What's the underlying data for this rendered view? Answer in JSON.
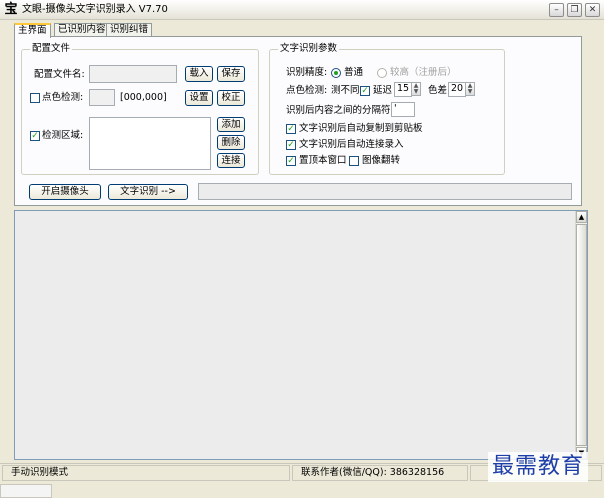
{
  "window": {
    "title": "文眼-摄像头文字识别录入 V7.70",
    "app_icon_glyph": "宝"
  },
  "titlebar_buttons": {
    "minimize": "–",
    "restore": "❐",
    "close": "✕"
  },
  "tabs": [
    {
      "label": "主界面",
      "active": true
    },
    {
      "label": "已识别内容",
      "active": false
    },
    {
      "label": "识别纠错",
      "active": false
    }
  ],
  "config": {
    "group_title": "配置文件",
    "config_name_label": "配置文件名:",
    "config_name_value": "",
    "load_button": "载入",
    "save_button": "保存",
    "color_detect_label": "点色检测:",
    "color_detect_checked": false,
    "color_detect_swatch": "",
    "color_detect_value": "[000,000]",
    "set_button": "设置",
    "calibrate_button": "校正",
    "detect_area_label": "检测区域:",
    "detect_area_checked": true,
    "detect_area_value": "",
    "add_button": "添加",
    "delete_button": "删除",
    "connect_button": "连接"
  },
  "ocr": {
    "group_title": "文字识别参数",
    "precision_label": "识别精度:",
    "precision_normal": "普通",
    "precision_high": "较高（注册后）",
    "color_detect_label": "点色检测:",
    "diff_label": "测不同",
    "diff_checked": true,
    "delay_label": "延迟",
    "delay_value": "15",
    "color_diff_label": "色差",
    "color_diff_value": "20",
    "separator_label": "识别后内容之间的分隔符:",
    "separator_value": "'",
    "auto_copy_label": "文字识别后自动复制到剪贴板",
    "auto_copy_checked": true,
    "auto_connect_label": "文字识别后自动连接录入",
    "auto_connect_checked": true,
    "top_window_label": "置顶本窗口",
    "top_window_checked": true,
    "flip_image_label": "图像翻转",
    "flip_image_checked": false
  },
  "actions": {
    "open_camera": "开启摄像头",
    "ocr_button": "文字识别 -->"
  },
  "status": {
    "mode": "手动识别模式",
    "contact": "联系作者(微信/QQ):    386328156"
  },
  "watermark": "最需教育",
  "icons": {
    "spin_up": "▲",
    "spin_down": "▼",
    "scroll_up": "▲",
    "scroll_down": "▼"
  }
}
